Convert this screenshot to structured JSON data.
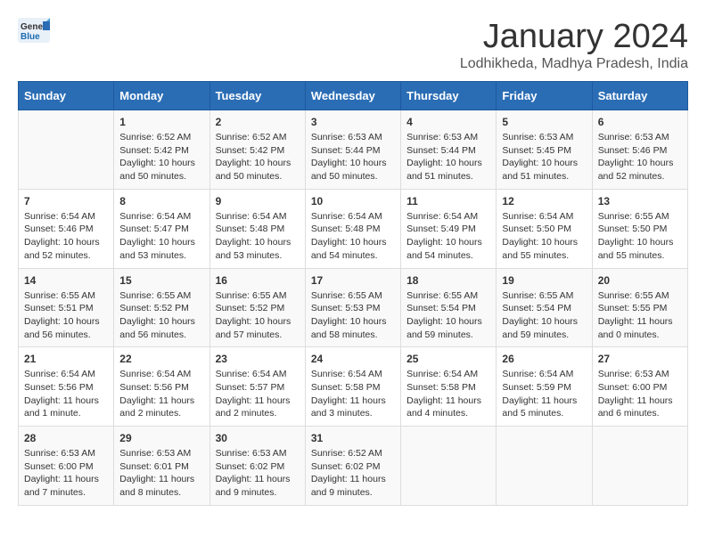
{
  "logo": {
    "text_general": "General",
    "text_blue": "Blue"
  },
  "header": {
    "month": "January 2024",
    "location": "Lodhikheda, Madhya Pradesh, India"
  },
  "days_of_week": [
    "Sunday",
    "Monday",
    "Tuesday",
    "Wednesday",
    "Thursday",
    "Friday",
    "Saturday"
  ],
  "weeks": [
    [
      {
        "day": "",
        "info": ""
      },
      {
        "day": "1",
        "info": "Sunrise: 6:52 AM\nSunset: 5:42 PM\nDaylight: 10 hours\nand 50 minutes."
      },
      {
        "day": "2",
        "info": "Sunrise: 6:52 AM\nSunset: 5:42 PM\nDaylight: 10 hours\nand 50 minutes."
      },
      {
        "day": "3",
        "info": "Sunrise: 6:53 AM\nSunset: 5:44 PM\nDaylight: 10 hours\nand 50 minutes."
      },
      {
        "day": "4",
        "info": "Sunrise: 6:53 AM\nSunset: 5:44 PM\nDaylight: 10 hours\nand 51 minutes."
      },
      {
        "day": "5",
        "info": "Sunrise: 6:53 AM\nSunset: 5:45 PM\nDaylight: 10 hours\nand 51 minutes."
      },
      {
        "day": "6",
        "info": "Sunrise: 6:53 AM\nSunset: 5:46 PM\nDaylight: 10 hours\nand 52 minutes."
      }
    ],
    [
      {
        "day": "7",
        "info": "Sunrise: 6:54 AM\nSunset: 5:46 PM\nDaylight: 10 hours\nand 52 minutes."
      },
      {
        "day": "8",
        "info": "Sunrise: 6:54 AM\nSunset: 5:47 PM\nDaylight: 10 hours\nand 53 minutes."
      },
      {
        "day": "9",
        "info": "Sunrise: 6:54 AM\nSunset: 5:48 PM\nDaylight: 10 hours\nand 53 minutes."
      },
      {
        "day": "10",
        "info": "Sunrise: 6:54 AM\nSunset: 5:48 PM\nDaylight: 10 hours\nand 54 minutes."
      },
      {
        "day": "11",
        "info": "Sunrise: 6:54 AM\nSunset: 5:49 PM\nDaylight: 10 hours\nand 54 minutes."
      },
      {
        "day": "12",
        "info": "Sunrise: 6:54 AM\nSunset: 5:50 PM\nDaylight: 10 hours\nand 55 minutes."
      },
      {
        "day": "13",
        "info": "Sunrise: 6:55 AM\nSunset: 5:50 PM\nDaylight: 10 hours\nand 55 minutes."
      }
    ],
    [
      {
        "day": "14",
        "info": "Sunrise: 6:55 AM\nSunset: 5:51 PM\nDaylight: 10 hours\nand 56 minutes."
      },
      {
        "day": "15",
        "info": "Sunrise: 6:55 AM\nSunset: 5:52 PM\nDaylight: 10 hours\nand 56 minutes."
      },
      {
        "day": "16",
        "info": "Sunrise: 6:55 AM\nSunset: 5:52 PM\nDaylight: 10 hours\nand 57 minutes."
      },
      {
        "day": "17",
        "info": "Sunrise: 6:55 AM\nSunset: 5:53 PM\nDaylight: 10 hours\nand 58 minutes."
      },
      {
        "day": "18",
        "info": "Sunrise: 6:55 AM\nSunset: 5:54 PM\nDaylight: 10 hours\nand 59 minutes."
      },
      {
        "day": "19",
        "info": "Sunrise: 6:55 AM\nSunset: 5:54 PM\nDaylight: 10 hours\nand 59 minutes."
      },
      {
        "day": "20",
        "info": "Sunrise: 6:55 AM\nSunset: 5:55 PM\nDaylight: 11 hours\nand 0 minutes."
      }
    ],
    [
      {
        "day": "21",
        "info": "Sunrise: 6:54 AM\nSunset: 5:56 PM\nDaylight: 11 hours\nand 1 minute."
      },
      {
        "day": "22",
        "info": "Sunrise: 6:54 AM\nSunset: 5:56 PM\nDaylight: 11 hours\nand 2 minutes."
      },
      {
        "day": "23",
        "info": "Sunrise: 6:54 AM\nSunset: 5:57 PM\nDaylight: 11 hours\nand 2 minutes."
      },
      {
        "day": "24",
        "info": "Sunrise: 6:54 AM\nSunset: 5:58 PM\nDaylight: 11 hours\nand 3 minutes."
      },
      {
        "day": "25",
        "info": "Sunrise: 6:54 AM\nSunset: 5:58 PM\nDaylight: 11 hours\nand 4 minutes."
      },
      {
        "day": "26",
        "info": "Sunrise: 6:54 AM\nSunset: 5:59 PM\nDaylight: 11 hours\nand 5 minutes."
      },
      {
        "day": "27",
        "info": "Sunrise: 6:53 AM\nSunset: 6:00 PM\nDaylight: 11 hours\nand 6 minutes."
      }
    ],
    [
      {
        "day": "28",
        "info": "Sunrise: 6:53 AM\nSunset: 6:00 PM\nDaylight: 11 hours\nand 7 minutes."
      },
      {
        "day": "29",
        "info": "Sunrise: 6:53 AM\nSunset: 6:01 PM\nDaylight: 11 hours\nand 8 minutes."
      },
      {
        "day": "30",
        "info": "Sunrise: 6:53 AM\nSunset: 6:02 PM\nDaylight: 11 hours\nand 9 minutes."
      },
      {
        "day": "31",
        "info": "Sunrise: 6:52 AM\nSunset: 6:02 PM\nDaylight: 11 hours\nand 9 minutes."
      },
      {
        "day": "",
        "info": ""
      },
      {
        "day": "",
        "info": ""
      },
      {
        "day": "",
        "info": ""
      }
    ]
  ]
}
